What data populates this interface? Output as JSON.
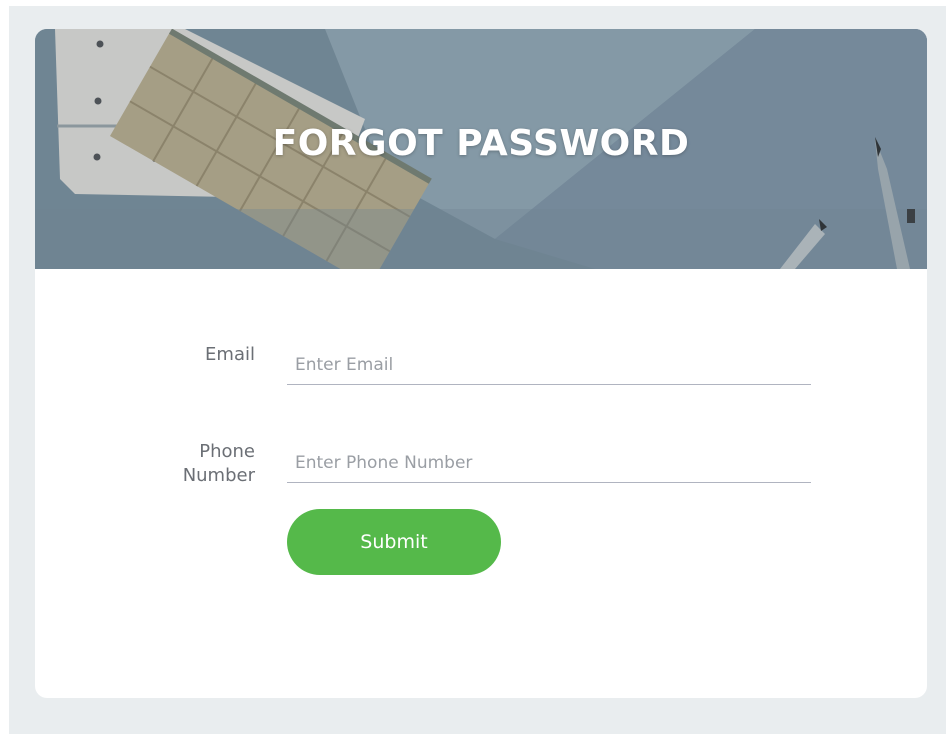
{
  "header": {
    "title": "FORGOT PASSWORD"
  },
  "form": {
    "email": {
      "label": "Email",
      "placeholder": "Enter Email",
      "value": ""
    },
    "phone": {
      "label": "Phone Number",
      "placeholder": "Enter Phone Number",
      "value": ""
    },
    "submit_label": "Submit"
  },
  "colors": {
    "page_background": "#e9edef",
    "card_background": "#ffffff",
    "banner_tint": "#6e8492",
    "submit_button": "#55b94a",
    "label_text": "#6b6f75",
    "input_underline": "#b0b4c0"
  }
}
